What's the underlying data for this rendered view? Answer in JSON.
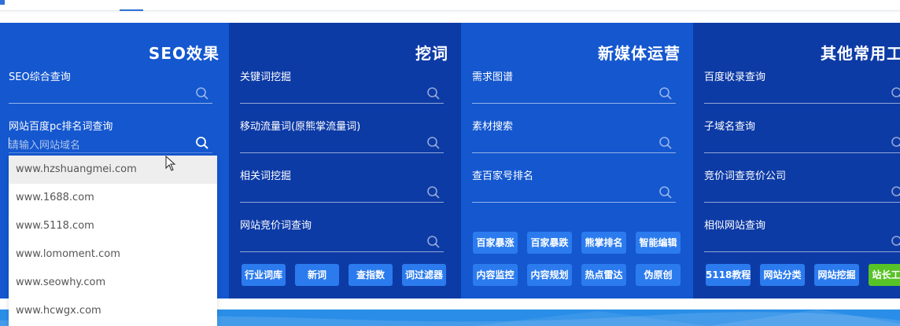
{
  "panels": {
    "seo": {
      "title": "SEO效果",
      "fields": [
        {
          "label": "SEO综合查询",
          "placeholder": ""
        },
        {
          "label": "网站百度pc排名词查询",
          "placeholder": "请输入网站域名"
        }
      ],
      "dropdown": [
        "www.hzshuangmei.com",
        "www.1688.com",
        "www.5118.com",
        "www.lomoment.com",
        "www.seowhy.com",
        "www.hcwgx.com"
      ]
    },
    "mining": {
      "title": "挖词",
      "fields": [
        {
          "label": "关键词挖掘"
        },
        {
          "label": "移动流量词(原熊掌流量词)"
        },
        {
          "label": "相关词挖掘"
        },
        {
          "label": "网站竞价词查询"
        }
      ],
      "buttons": [
        "行业词库",
        "新词",
        "查指数",
        "词过滤器"
      ]
    },
    "media": {
      "title": "新媒体运营",
      "fields": [
        {
          "label": "需求图谱"
        },
        {
          "label": "素材搜索"
        },
        {
          "label": "查百家号排名"
        }
      ],
      "buttons_row1": [
        "百家暴涨",
        "百家暴跌",
        "熊掌排名",
        "智能编辑"
      ],
      "buttons_row2": [
        "内容监控",
        "内容规划",
        "热点雷达",
        "伪原创"
      ]
    },
    "other": {
      "title": "其他常用工具",
      "fields": [
        {
          "label": "百度收录查询"
        },
        {
          "label": "子域名查询"
        },
        {
          "label": "竞价词查竞价公司"
        },
        {
          "label": "相似网站查询"
        }
      ],
      "buttons": [
        "5118教程",
        "网站分类",
        "网站挖掘",
        "站长工具"
      ]
    }
  },
  "colors": {
    "panel_light": "#1457cf",
    "panel_dark": "#0d3ba6",
    "button": "#2b7bee",
    "button_green": "#58c327",
    "footer": "#2a8ee8"
  },
  "icons": {
    "search": "search-icon",
    "cursor": "mouse-pointer-icon"
  }
}
